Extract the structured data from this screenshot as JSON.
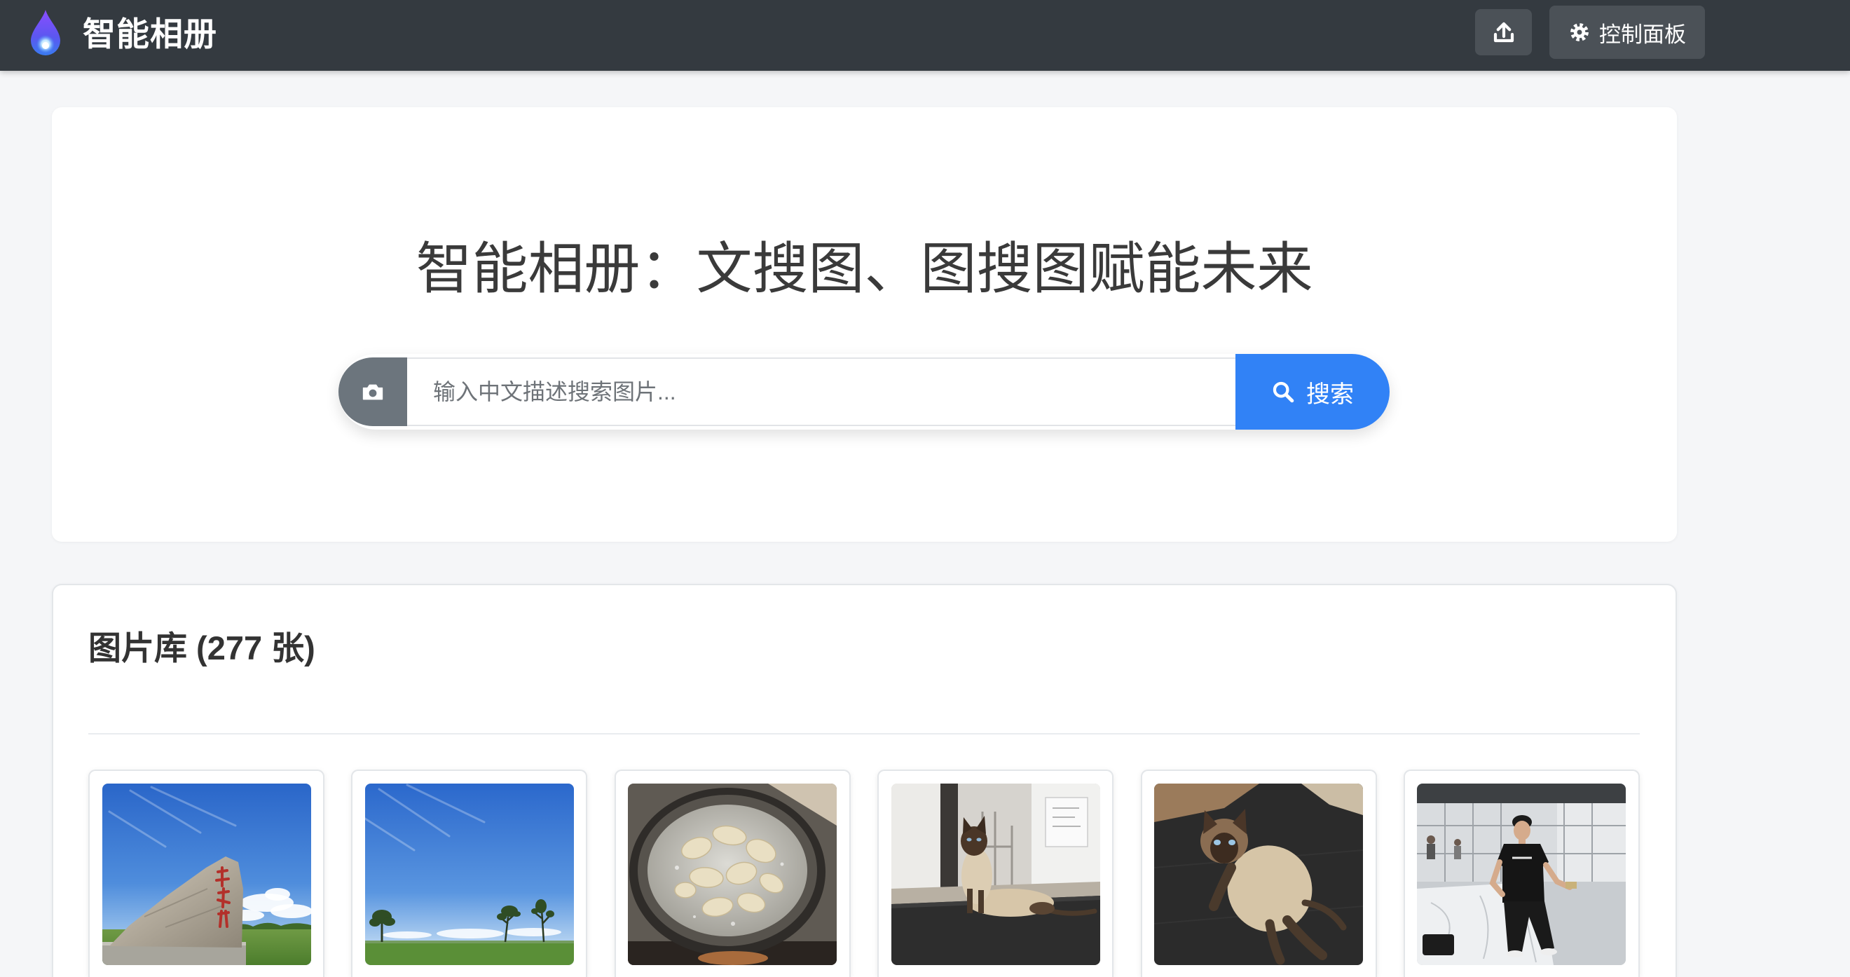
{
  "theme": {
    "navbar_bg": "#343a40",
    "nav_button_bg": "#4b5157",
    "primary": "#3182f6",
    "secondary": "#6c757d",
    "page_bg": "#f5f6f8"
  },
  "navbar": {
    "logo_icon": "droplet-logo-icon",
    "brand": "智能相册",
    "upload_icon": "upload-icon",
    "dashboard_icon": "gear-icon",
    "dashboard_label": "控制面板"
  },
  "hero": {
    "title": "智能相册：文搜图、图搜图赋能未来"
  },
  "search": {
    "image_search_icon": "camera-icon",
    "placeholder": "输入中文描述搜索图片...",
    "value": "",
    "button_icon": "search-icon",
    "button_label": "搜索"
  },
  "gallery": {
    "title": "图片库 (277 张)"
  }
}
